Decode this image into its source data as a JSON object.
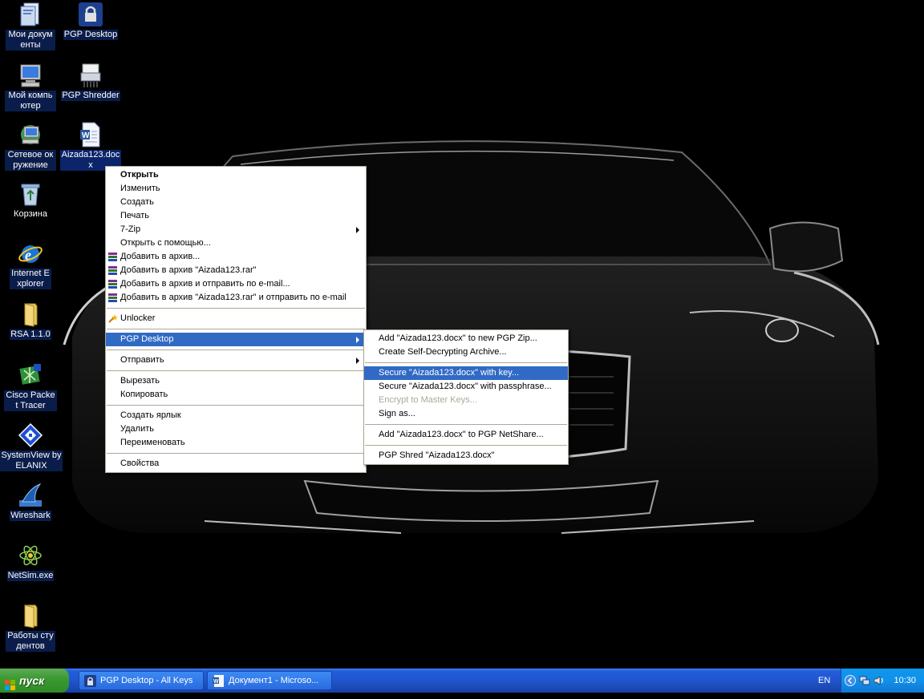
{
  "desktop": {
    "icons": [
      {
        "label": "Мои документы",
        "icon": "my-documents-icon"
      },
      {
        "label": "PGP Desktop",
        "icon": "pgp-lock-icon"
      },
      {
        "label": "Мой компьютер",
        "icon": "my-computer-icon"
      },
      {
        "label": "PGP Shredder",
        "icon": "shredder-icon"
      },
      {
        "label": "Сетевое окружение",
        "icon": "network-places-icon"
      },
      {
        "label": "Aizada123.docx",
        "icon": "word-document-icon"
      },
      {
        "label": "Корзина",
        "icon": "recycle-bin-icon"
      },
      {
        "label": "Internet Explorer",
        "icon": "internet-explorer-icon"
      },
      {
        "label": "RSA 1.1.0",
        "icon": "folder-icon"
      },
      {
        "label": "Cisco Packet Tracer",
        "icon": "packet-tracer-icon"
      },
      {
        "label": "SystemView by ELANIX",
        "icon": "systemview-icon"
      },
      {
        "label": "Wireshark",
        "icon": "wireshark-fin-icon"
      },
      {
        "label": "NetSim.exe",
        "icon": "netsim-atom-icon"
      },
      {
        "label": "Работы студентов",
        "icon": "folder-icon"
      }
    ]
  },
  "context_menu": {
    "items": [
      {
        "label": "Открыть"
      },
      {
        "label": "Изменить"
      },
      {
        "label": "Создать"
      },
      {
        "label": "Печать"
      },
      {
        "label": "7-Zip"
      },
      {
        "label": "Открыть с помощью..."
      },
      {
        "label": "Добавить в архив..."
      },
      {
        "label": "Добавить в архив \"Aizada123.rar\""
      },
      {
        "label": "Добавить в архив и отправить по e-mail..."
      },
      {
        "label": "Добавить в архив \"Aizada123.rar\" и отправить по e-mail"
      },
      {
        "label": "Unlocker"
      },
      {
        "label": "PGP Desktop"
      },
      {
        "label": "Отправить"
      },
      {
        "label": "Вырезать"
      },
      {
        "label": "Копировать"
      },
      {
        "label": "Создать ярлык"
      },
      {
        "label": "Удалить"
      },
      {
        "label": "Переименовать"
      },
      {
        "label": "Свойства"
      }
    ]
  },
  "pgp_submenu": {
    "items": [
      {
        "label": "Add \"Aizada123.docx\" to new PGP Zip..."
      },
      {
        "label": "Create Self-Decrypting Archive..."
      },
      {
        "label": "Secure \"Aizada123.docx\" with key..."
      },
      {
        "label": "Secure \"Aizada123.docx\" with passphrase..."
      },
      {
        "label": "Encrypt to Master Keys..."
      },
      {
        "label": "Sign as..."
      },
      {
        "label": "Add \"Aizada123.docx\" to PGP NetShare..."
      },
      {
        "label": "PGP Shred \"Aizada123.docx\""
      }
    ]
  },
  "taskbar": {
    "start_label": "пуск",
    "buttons": [
      {
        "label": "PGP Desktop - All Keys"
      },
      {
        "label": "Документ1 - Microso..."
      }
    ],
    "language": "EN",
    "clock": "10:30"
  },
  "colors": {
    "menu_highlight": "#316ac5",
    "taskbar_blue": "#245edb",
    "start_green": "#3c9a32",
    "selected_label": "#0b246a"
  }
}
